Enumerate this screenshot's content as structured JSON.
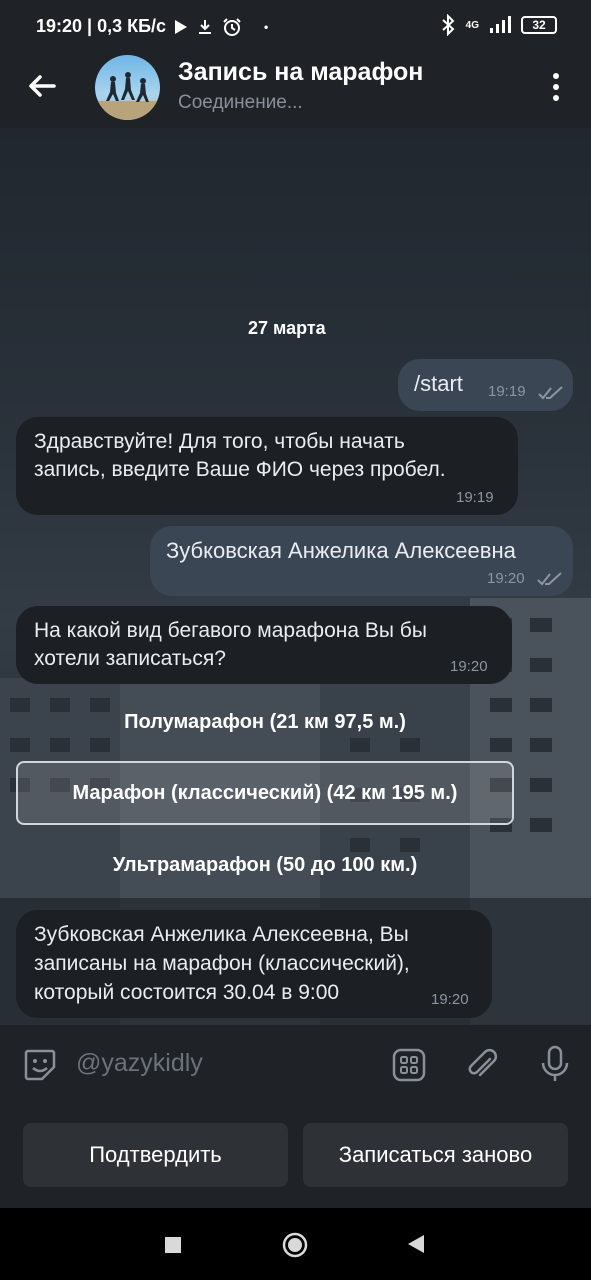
{
  "status_bar": {
    "time_speed": "19:20 | 0,3 КБ/с",
    "dot": "•",
    "network": "4G",
    "battery": "32"
  },
  "header": {
    "title": "Запись на марафон",
    "subtitle": "Соединение..."
  },
  "chat": {
    "date": "27 марта",
    "messages": [
      {
        "text": "/start",
        "time": "19:19"
      },
      {
        "text_line1": "Здравствуйте! Для того, чтобы начать",
        "text_line2": "запись, введите Ваше ФИО через пробел.",
        "time": "19:19"
      },
      {
        "text": "Зубковская Анжелика Алексеевна",
        "time": "19:20"
      },
      {
        "text_line1": "На какой вид бегавого марафона Вы бы",
        "text_line2": "хотели записаться?",
        "time": "19:20"
      },
      {
        "text_line1": "Зубковская Анжелика Алексеевна, Вы",
        "text_line2": "записаны на марафон (классический),",
        "text_line3": "который состоится 30.04 в 9:00",
        "time": "19:20"
      }
    ],
    "inline_buttons": [
      "Полумарафон (21 км 97,5 м.)",
      "Марафон (классический) (42 км 195 м.)",
      "Ультрамарафон (50 до 100 км.)"
    ]
  },
  "input": {
    "placeholder": "@yazykidly"
  },
  "reply_keyboard": {
    "confirm": "Подтвердить",
    "restart": "Записаться заново"
  },
  "colors": {
    "bar_bg": "#1f2226",
    "bubble_out": "#3b4655",
    "bubble_in": "#1c1f24"
  }
}
